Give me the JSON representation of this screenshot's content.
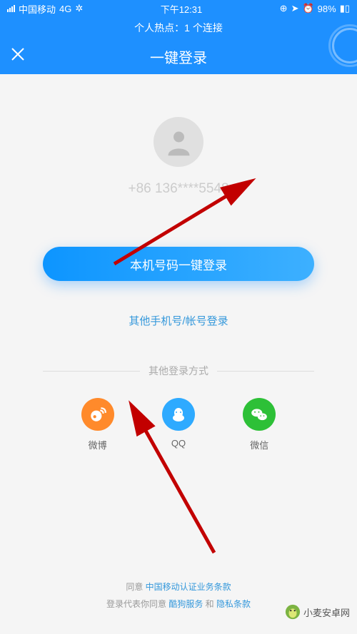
{
  "status": {
    "carrier": "中国移动",
    "network": "4G",
    "time": "下午12:31",
    "battery": "98%"
  },
  "hotspot": "个人热点：1 个连接",
  "header": {
    "title": "一键登录"
  },
  "phone": "+86 136****5548",
  "buttons": {
    "primary": "本机号码一键登录",
    "other": "其他手机号/帐号登录"
  },
  "divider": "其他登录方式",
  "social": {
    "weibo": "微博",
    "qq": "QQ",
    "wechat": "微信"
  },
  "terms": {
    "line1_prefix": "同意",
    "line1_link": "中国移动认证业务条款",
    "line2_prefix": "登录代表你同意",
    "line2_link1": "酷狗服务",
    "line2_and": "和",
    "line2_link2": "隐私条款"
  },
  "watermark": "小麦安卓网"
}
